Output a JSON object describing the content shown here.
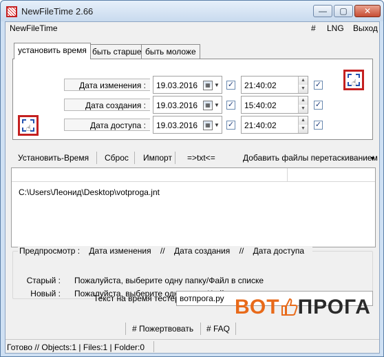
{
  "window": {
    "title": "NewFileTime 2.66"
  },
  "titlebar_buttons": {
    "minimize": "—",
    "maximize": "▢",
    "close": "✕"
  },
  "menu": {
    "left": "NewFileTime",
    "hash": "#",
    "lng": "LNG",
    "exit": "Выход"
  },
  "tabs": [
    "установить время",
    "быть старше",
    "быть моложе"
  ],
  "date_rows": [
    {
      "label": "Дата изменения :",
      "date": "19.03.2016",
      "time": "21:40:02",
      "date_checked": "✓",
      "time_checked": "✓"
    },
    {
      "label": "Дата создания :",
      "date": "19.03.2016",
      "time": "15:40:02",
      "date_checked": "✓",
      "time_checked": "✓"
    },
    {
      "label": "Дата доступа :",
      "date": "19.03.2016",
      "time": "21:40:02",
      "date_checked": "✓",
      "time_checked": "✓"
    }
  ],
  "toolbar": {
    "set_time": "Установить-Время",
    "reset": "Сброс",
    "import": "Импорт",
    "to_txt": "=>txt<=",
    "add_files": "Добавить файлы перетаскиванием",
    "dropdown_arrow": "▼"
  },
  "file_list": {
    "items": [
      "C:\\Users\\Леонид\\Desktop\\votproga.jnt"
    ]
  },
  "preview": {
    "title": "Предпросмотр  :",
    "col1": "Дата изменения",
    "sep1": "//",
    "col2": "Дата создания",
    "sep2": "//",
    "col3": "Дата доступа",
    "old_label": "Старый :",
    "old_value": "Пожалуйста, выберите одну папку/Файл в списке",
    "new_label": "Новый :",
    "new_value": "Пожалуйста, выберите одну папку/Файл в списке"
  },
  "tester": {
    "label": "Текст на время тестер",
    "value": "вотпрога.ру"
  },
  "bottom": {
    "donate": "# Пожертвовать",
    "faq": "# FAQ"
  },
  "status": {
    "text": "Готово // Objects:1 | Files:1  | Folder:0"
  },
  "watermark": {
    "part1": "ВОТ",
    "part2": "ПРОГА"
  },
  "icons": {
    "app": "app-icon",
    "calendar": "calendar-icon",
    "hand": "hand-icon"
  },
  "colors": {
    "accent_orange": "#e86a1a",
    "icon_red": "#c42020",
    "icon_blue": "#2453b0"
  }
}
